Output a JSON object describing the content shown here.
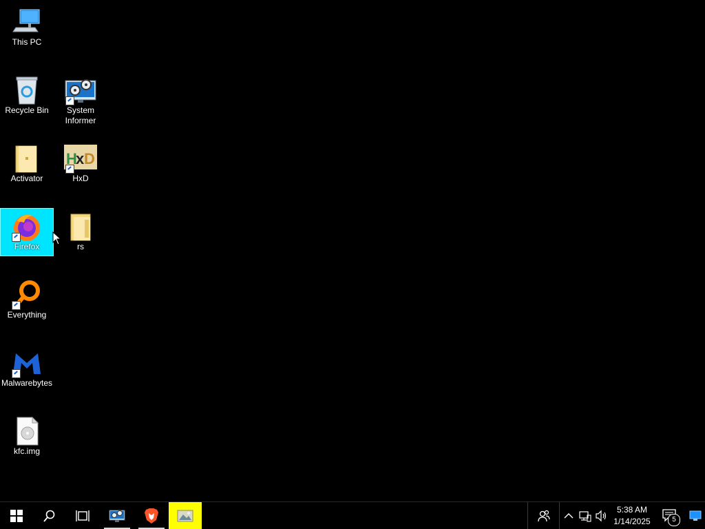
{
  "desktop": {
    "icons": [
      {
        "label": "This PC"
      },
      {
        "label": "Recycle Bin"
      },
      {
        "label": "System\nInformer"
      },
      {
        "label": "Activator"
      },
      {
        "label": "HxD"
      },
      {
        "label": "Firefox"
      },
      {
        "label": "rs"
      },
      {
        "label": "Everything"
      },
      {
        "label": "Malwarebytes"
      },
      {
        "label": "kfc.img"
      }
    ],
    "selected_icon": "Firefox"
  },
  "taskbar": {
    "clock_time": "5:38 AM",
    "clock_date": "1/14/2025",
    "notification_count": "5",
    "pinned": [
      "start-icon",
      "search-icon",
      "task-view-icon",
      "system-informer-icon",
      "brave-icon",
      "image-viewer-icon"
    ]
  },
  "colors": {
    "desktop_bg": "#000000",
    "selection": "#00e5ff",
    "taskbar_bg": "#000000",
    "highlight_app": "#ffff00"
  }
}
